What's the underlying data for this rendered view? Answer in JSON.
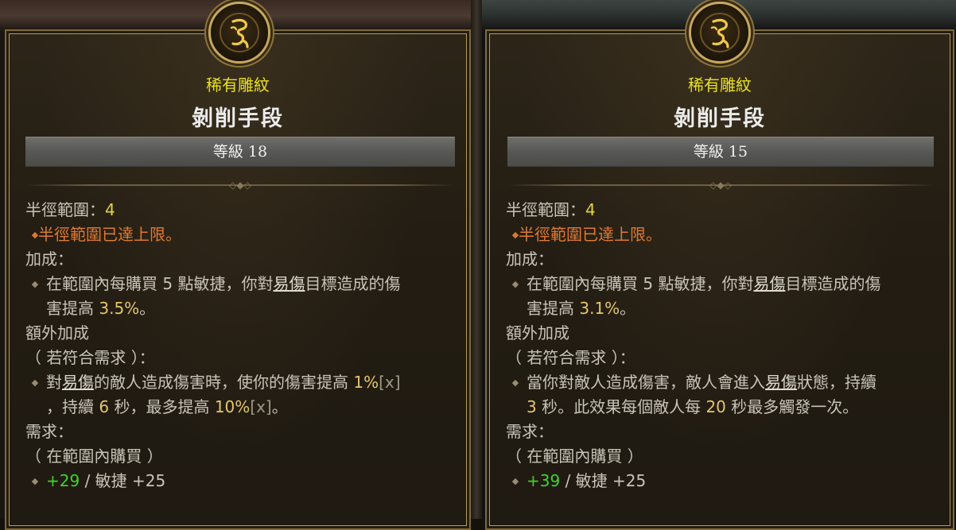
{
  "tooltips": [
    {
      "rarity": "稀有雕紋",
      "name": "剝削手段",
      "level": "等級 18",
      "radius_label": "半徑範圍：",
      "radius_value": "4",
      "radius_note": "半徑範圍已達上限。",
      "bonus_header": "加成：",
      "bonus": {
        "p1": "在範圍內每購買 5 點敏捷，你對",
        "kw": "易傷",
        "p2": "目標造成的傷",
        "p3": "害提高 ",
        "value": "3.5%",
        "p4": "。"
      },
      "extra_header": "額外加成",
      "extra_condition": "（ 若符合需求 ）：",
      "extra": {
        "p1": "對",
        "kw": "易傷",
        "p2": "的敵人造成傷害時，使你的傷害提高 ",
        "v1": "1%",
        "x1": "[x]",
        "p3": "，持續 ",
        "v2": "6",
        "p4": " 秒，最多提高 ",
        "v3": "10%",
        "x2": "[x]",
        "p5": "。"
      },
      "req_header": "需求：",
      "req_condition": "（ 在範圍內購買 ）",
      "req": {
        "current": "+29",
        "sep": " / ",
        "stat": "敏捷 +25"
      }
    },
    {
      "rarity": "稀有雕紋",
      "name": "剝削手段",
      "level": "等級 15",
      "radius_label": "半徑範圍：",
      "radius_value": "4",
      "radius_note": "半徑範圍已達上限。",
      "bonus_header": "加成：",
      "bonus": {
        "p1": "在範圍內每購買 5 點敏捷，你對",
        "kw": "易傷",
        "p2": "目標造成的傷",
        "p3": "害提高 ",
        "value": "3.1%",
        "p4": "。"
      },
      "extra_header": "額外加成",
      "extra_condition": "（ 若符合需求 ）：",
      "extra": {
        "p1": "當你對敵人造成傷害，敵人會進入",
        "kw": "易傷",
        "p2": "狀態，持續",
        "v1": "3",
        "p3": " 秒。此效果每個敵人每 ",
        "v2": "20",
        "p4": " 秒最多觸發一次。"
      },
      "req_header": "需求：",
      "req_condition": "（ 在範圍內購買 ）",
      "req": {
        "current": "+39",
        "sep": " / ",
        "stat": "敏捷 +25"
      }
    }
  ],
  "colors": {
    "rarity": "#e8e020",
    "value": "#e6c56a",
    "warning": "#e07a32",
    "requirement_met": "#3fd42a",
    "frame_gold": "#b89a4e"
  },
  "icons": {
    "emblem": "glyph-emblem-icon",
    "bullet": "diamond-bullet-icon"
  }
}
